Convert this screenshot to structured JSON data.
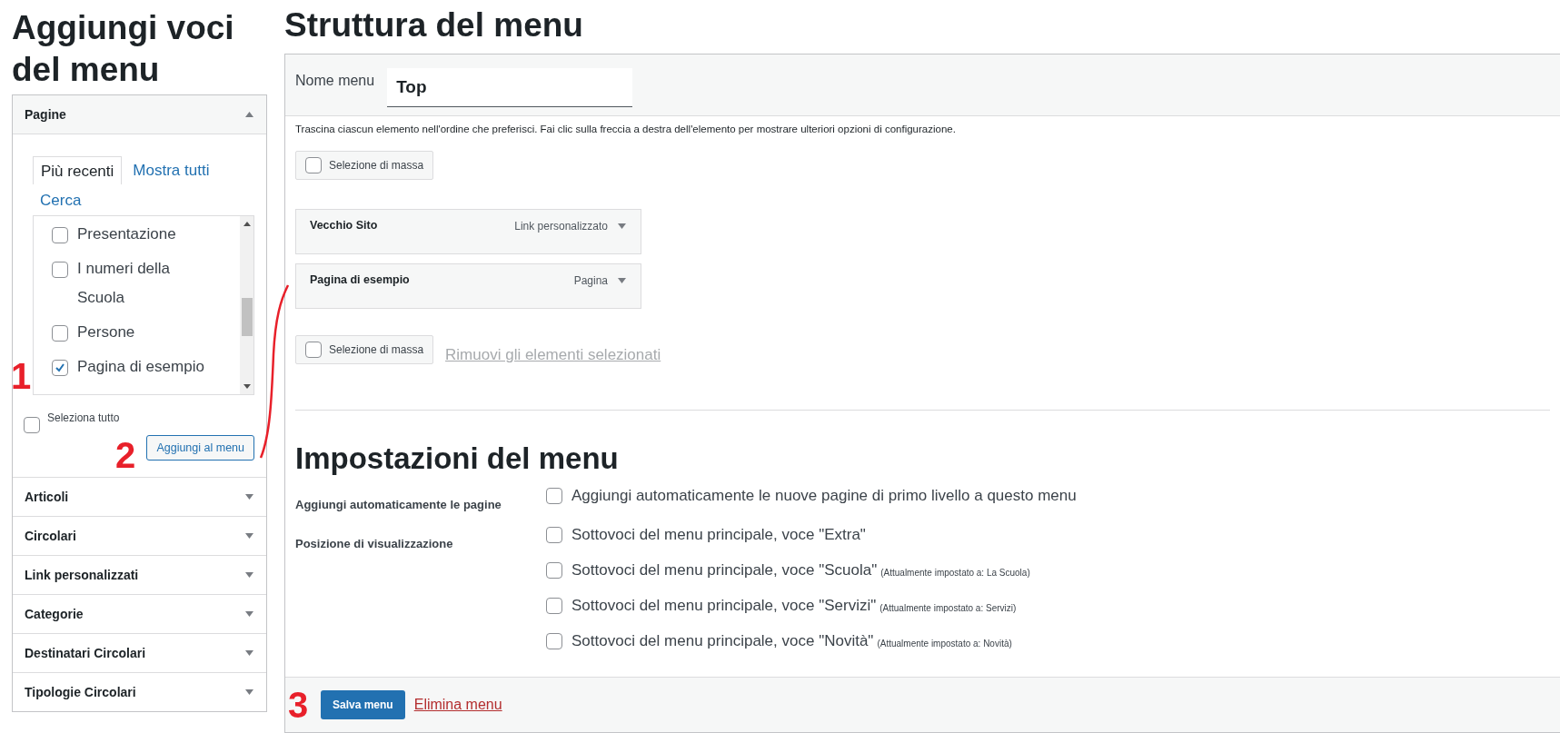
{
  "left": {
    "title": "Aggiungi voci del menu",
    "panels": [
      {
        "label": "Pagine",
        "expanded": true
      },
      {
        "label": "Articoli",
        "expanded": false
      },
      {
        "label": "Circolari",
        "expanded": false
      },
      {
        "label": "Link personalizzati",
        "expanded": false
      },
      {
        "label": "Categorie",
        "expanded": false
      },
      {
        "label": "Destinatari Circolari",
        "expanded": false
      },
      {
        "label": "Tipologie Circolari",
        "expanded": false
      }
    ],
    "pages_panel": {
      "tabs": [
        {
          "label": "Più recenti",
          "selected": true
        },
        {
          "label": "Mostra tutti",
          "selected": false
        },
        {
          "label": "Cerca",
          "selected": false
        }
      ],
      "items": [
        {
          "label": "Presentazione",
          "checked": false
        },
        {
          "label": "I numeri della Scuola",
          "checked": false
        },
        {
          "label": "Persone",
          "checked": false
        },
        {
          "label": "Pagina di esempio",
          "checked": true
        }
      ],
      "select_all": {
        "label": "Seleziona tutto",
        "checked": false
      },
      "add_button": "Aggiungi al menu"
    }
  },
  "structure": {
    "title": "Struttura del menu",
    "name_label": "Nome menu",
    "name_value": "Top",
    "instructions": "Trascina ciascun elemento nell'ordine che preferisci. Fai clic sulla freccia a destra dell'elemento per mostrare ulteriori opzioni di configurazione.",
    "bulk_select_top": {
      "label": "Selezione di massa",
      "checked": false
    },
    "items": [
      {
        "title": "Vecchio Sito",
        "type": "Link personalizzato"
      },
      {
        "title": "Pagina di esempio",
        "type": "Pagina"
      }
    ],
    "bulk_select_bottom": {
      "label": "Selezione di massa",
      "checked": false
    },
    "remove_link": {
      "label": "Rimuovi gli elementi selezionati",
      "disabled": true
    }
  },
  "settings": {
    "title": "Impostazioni del menu",
    "rows": [
      {
        "label": "Aggiungi automaticamente le pagine",
        "options": [
          {
            "label": "Aggiungi automaticamente le nuove pagine di primo livello a questo menu",
            "checked": false
          }
        ]
      },
      {
        "label": "Posizione di visualizzazione",
        "options": [
          {
            "label": "Sottovoci del menu principale, voce \"Extra\"",
            "checked": false
          },
          {
            "label": "Sottovoci del menu principale, voce \"Scuola\"",
            "note": "(Attualmente impostato a: La Scuola)",
            "checked": false
          },
          {
            "label": "Sottovoci del menu principale, voce \"Servizi\"",
            "note": "(Attualmente impostato a: Servizi)",
            "checked": false
          },
          {
            "label": "Sottovoci del menu principale, voce \"Novità\"",
            "note": "(Attualmente impostato a: Novità)",
            "checked": false
          }
        ]
      }
    ]
  },
  "footer": {
    "save": "Salva menu",
    "delete": "Elimina menu"
  },
  "annotations": [
    {
      "label": "1"
    },
    {
      "label": "2"
    },
    {
      "label": "3"
    }
  ]
}
